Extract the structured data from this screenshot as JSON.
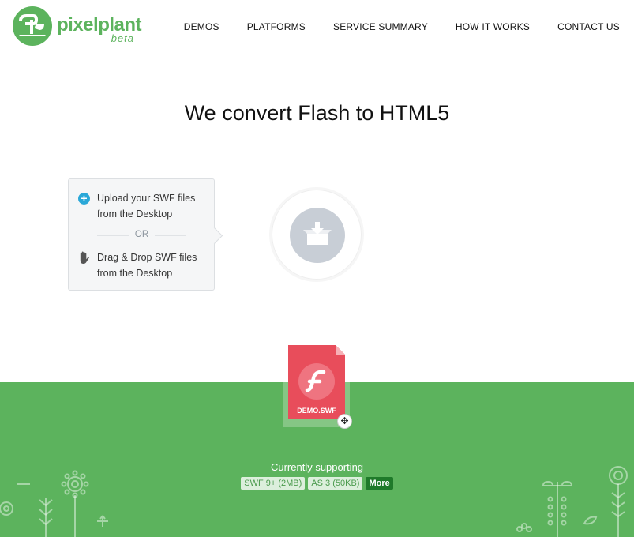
{
  "brand": {
    "name": "pixelplant",
    "tag": "beta",
    "color": "#5cb35d"
  },
  "nav": {
    "items": [
      "DEMOS",
      "PLATFORMS",
      "SERVICE SUMMARY",
      "HOW IT WORKS",
      "CONTACT US"
    ]
  },
  "hero": {
    "headline": "We convert Flash to HTML5"
  },
  "upload": {
    "option1_line1": "Upload your SWF files",
    "option1_line2": "from the Desktop",
    "divider": "OR",
    "option2_line1": "Drag & Drop SWF files",
    "option2_line2": "from the Desktop",
    "icons": {
      "upload": "plus-circle-icon",
      "drag": "hand-icon",
      "drop": "download-box-icon"
    }
  },
  "demo_file": {
    "label": "DEMO.SWF",
    "icon": "flash-icon",
    "color": "#e84d5b",
    "move_icon": "move-icon"
  },
  "support": {
    "title": "Currently supporting",
    "badges": [
      "SWF 9+ (2MB)",
      "AS 3 (50KB)"
    ],
    "more": "More"
  }
}
